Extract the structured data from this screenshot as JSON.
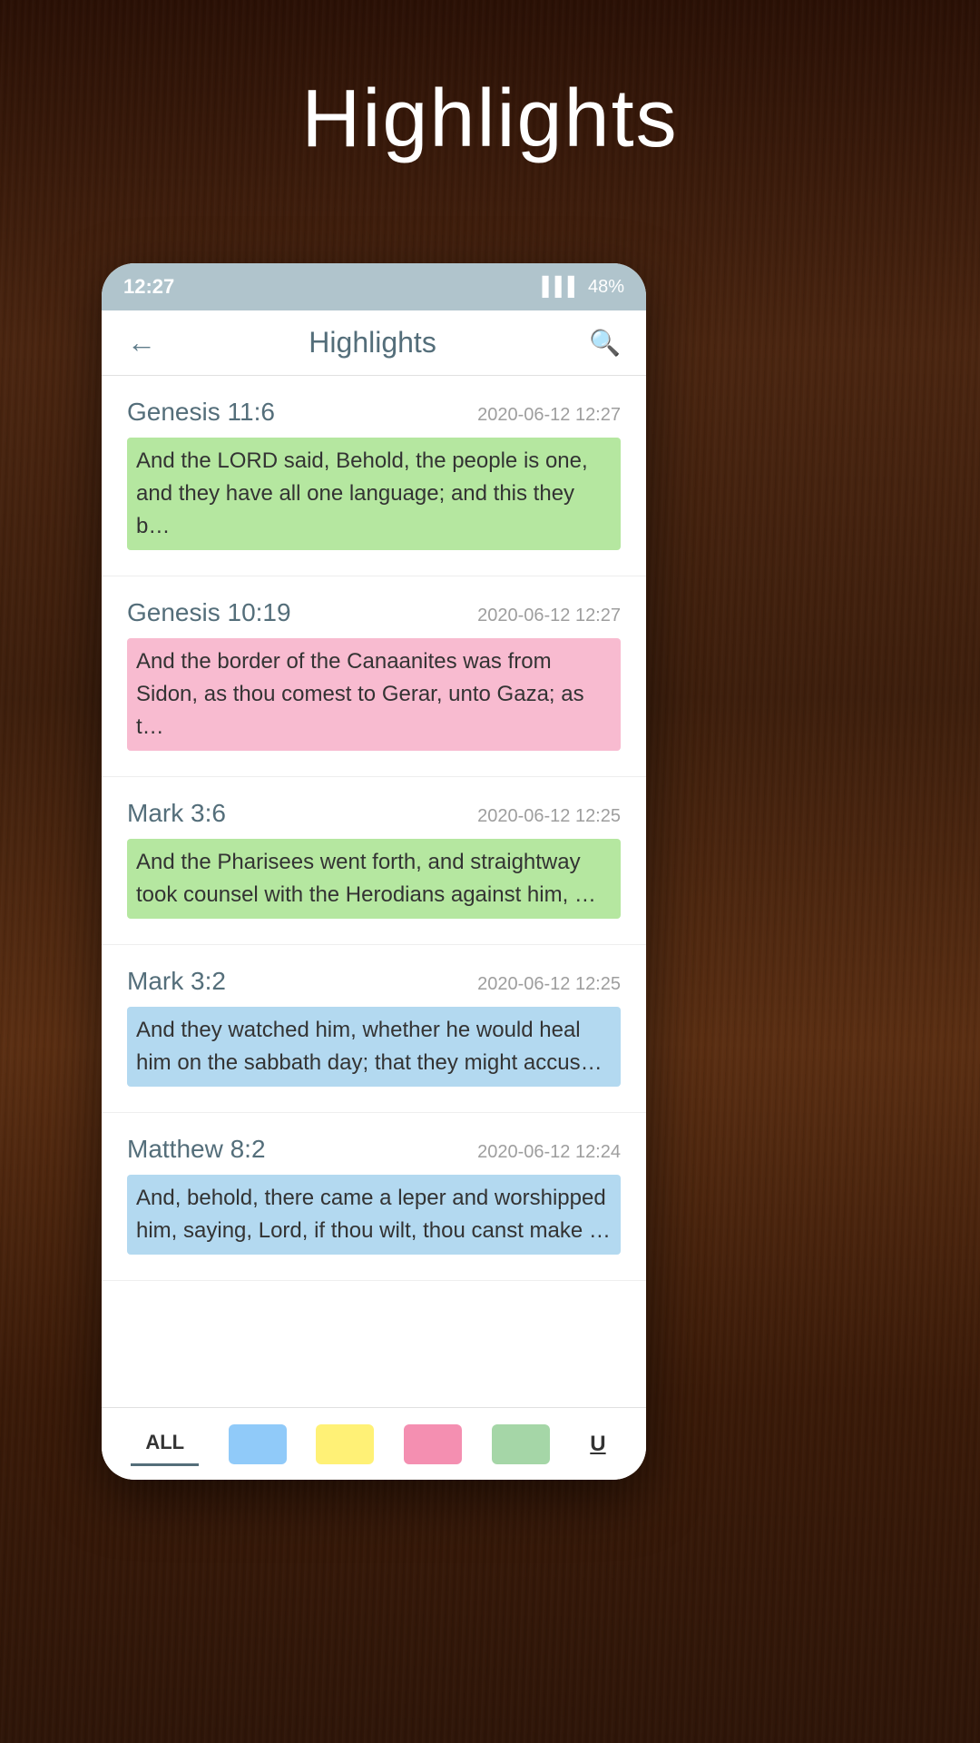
{
  "page": {
    "title": "Highlights",
    "background_color": "#3a1e0a"
  },
  "status_bar": {
    "time": "12:27",
    "battery": "48%",
    "signal": "▌▌▌",
    "background": "#b0c4cc"
  },
  "header": {
    "title": "Highlights",
    "back_icon": "←",
    "search_icon": "🔍"
  },
  "highlights": [
    {
      "ref": "Genesis 11:6",
      "date": "2020-06-12 12:27",
      "text": "And the LORD said, Behold, the people is one, and they have all one language; and this they b…",
      "highlight_class": "hl-green"
    },
    {
      "ref": "Genesis 10:19",
      "date": "2020-06-12 12:27",
      "text": "And the border of the Canaanites was from Sidon, as thou comest to Gerar, unto Gaza; as t…",
      "highlight_class": "hl-pink"
    },
    {
      "ref": "Mark 3:6",
      "date": "2020-06-12 12:25",
      "text": "And the Pharisees went forth, and straightway took counsel with the Herodians against him, …",
      "highlight_class": "hl-green"
    },
    {
      "ref": "Mark 3:2",
      "date": "2020-06-12 12:25",
      "text": "And they watched him, whether he would heal him on the sabbath day; that they might accus…",
      "highlight_class": "hl-blue"
    },
    {
      "ref": "Matthew 8:2",
      "date": "2020-06-12 12:24",
      "text": "And, behold, there came a leper and worshipped him, saying, Lord, if thou wilt, thou canst make …",
      "highlight_class": "hl-blue"
    }
  ],
  "filter_bar": {
    "all_label": "ALL",
    "underline_label": "U",
    "colors": [
      "blue",
      "yellow",
      "pink",
      "green"
    ]
  }
}
